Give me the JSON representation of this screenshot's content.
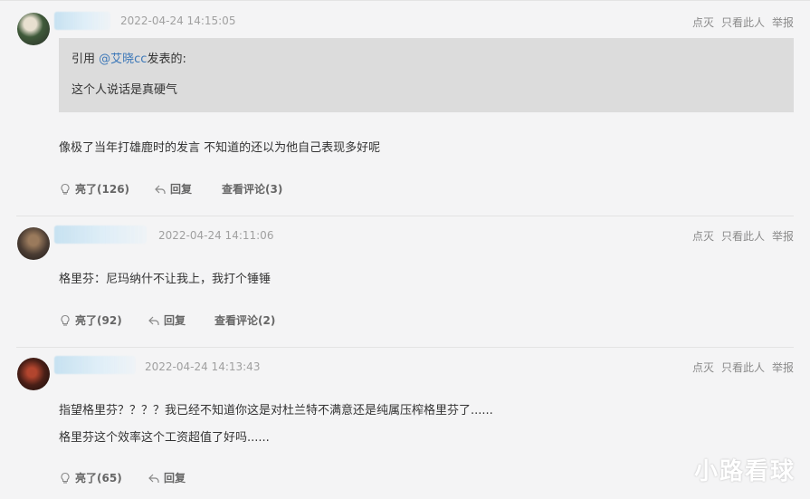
{
  "ops": {
    "downvote": "点灭",
    "only_this": "只看此人",
    "report": "举报"
  },
  "actions": {
    "like": "亮了",
    "reply": "回复",
    "view_comments": "查看评论"
  },
  "comments": [
    {
      "time": "2022-04-24 14:15:05",
      "quote": {
        "prefix": "引用 ",
        "user": "@艾晓cc",
        "suffix": "发表的:",
        "body": "这个人说话是真硬气"
      },
      "lines": [
        "像极了当年打雄鹿时的发言 不知道的还以为他自己表现多好呢"
      ],
      "likes": "(126)",
      "comments_count": "(3)"
    },
    {
      "time": "2022-04-24 14:11:06",
      "lines": [
        "格里芬：尼玛纳什不让我上，我打个锤锤"
      ],
      "likes": "(92)",
      "comments_count": "(2)"
    },
    {
      "time": "2022-04-24 14:13:43",
      "lines": [
        "指望格里芬？？？？我已经不知道你这是对杜兰特不满意还是纯属压榨格里芬了......",
        "格里芬这个效率这个工资超值了好吗......"
      ],
      "likes": "(65)"
    }
  ],
  "watermark": "小路看球"
}
